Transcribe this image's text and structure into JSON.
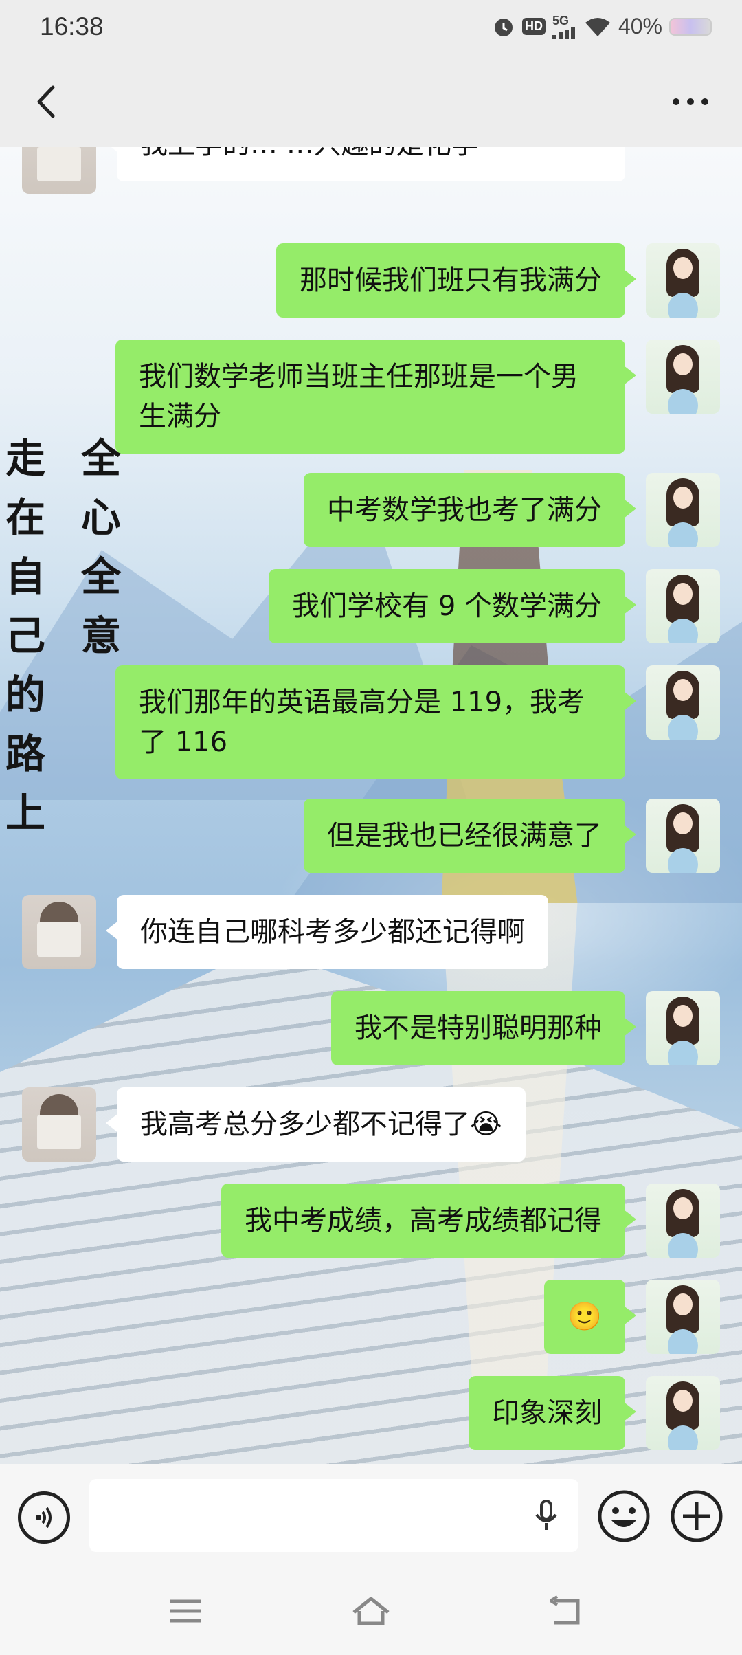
{
  "status_bar": {
    "time": "16:38",
    "hd": "HD",
    "network": "5G",
    "battery": "40%"
  },
  "header": {
    "back_icon": "chevron-left-icon",
    "more_icon": "more-dots-icon"
  },
  "wallpaper": {
    "calligraphy_left": [
      "走",
      "在",
      "自",
      "己",
      "的",
      "路",
      "上"
    ],
    "calligraphy_right": [
      "全",
      "心",
      "全",
      "意"
    ]
  },
  "messages": [
    {
      "from": "them",
      "text": "我上学的…  …兴趣的是化学"
    },
    {
      "from": "me",
      "text": "那时候我们班只有我满分"
    },
    {
      "from": "me",
      "text": "我们数学老师当班主任那班是一个男生满分"
    },
    {
      "from": "me",
      "text": "中考数学我也考了满分"
    },
    {
      "from": "me",
      "text": "我们学校有 9 个数学满分"
    },
    {
      "from": "me",
      "text": "我们那年的英语最高分是 119，我考了 116"
    },
    {
      "from": "me",
      "text": "但是我也已经很满意了"
    },
    {
      "from": "them",
      "text": "你连自己哪科考多少都还记得啊"
    },
    {
      "from": "me",
      "text": "我不是特别聪明那种"
    },
    {
      "from": "them",
      "text": "我高考总分多少都不记得了😭"
    },
    {
      "from": "me",
      "text": "我中考成绩，高考成绩都记得"
    },
    {
      "from": "me",
      "text": "🙂"
    },
    {
      "from": "me",
      "text": "印象深刻"
    }
  ],
  "input": {
    "placeholder": "",
    "voice_icon": "voice-icon",
    "mic_icon": "mic-icon",
    "emoji_icon": "emoji-icon",
    "plus_icon": "plus-icon"
  },
  "system_nav": [
    "menu-icon",
    "home-icon",
    "back-icon"
  ],
  "colors": {
    "my_bubble": "#95ec69",
    "their_bubble": "#ffffff",
    "bar_bg": "#ededed"
  }
}
